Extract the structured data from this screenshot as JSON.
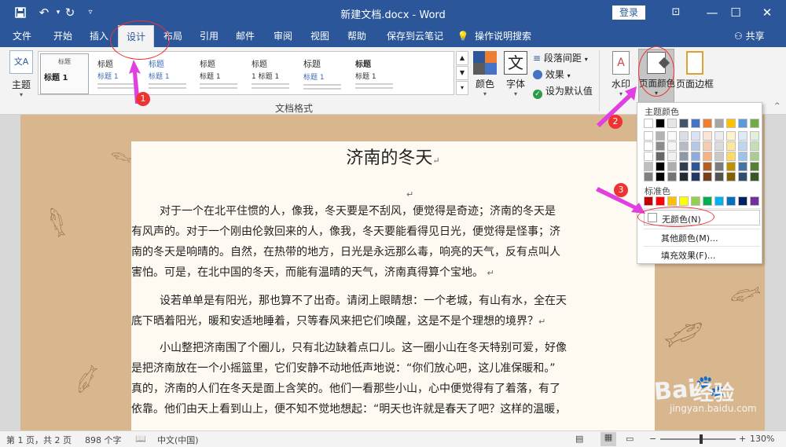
{
  "window": {
    "title": "新建文档.docx  -  Word",
    "login": "登录",
    "save_icon": "save-icon",
    "undo_icon": "undo-icon",
    "redo_icon": "redo-icon",
    "customize_icon": "customize-icon",
    "controls": {
      "display_options": "⊡",
      "minimize": "—",
      "maximize": "☐",
      "close": "✕"
    }
  },
  "tabs": [
    "文件",
    "开始",
    "插入",
    "设计",
    "布局",
    "引用",
    "邮件",
    "审阅",
    "视图",
    "帮助",
    "保存到云笔记",
    "操作说明搜索"
  ],
  "active_tab": "设计",
  "share": "共享",
  "ribbon": {
    "theme_label": "主题",
    "gallery_styles": [
      {
        "head": "标题",
        "sub": "标题 1"
      },
      {
        "head": "标题",
        "sub": "标题 1"
      },
      {
        "head": "标题",
        "sub": "标题 1"
      },
      {
        "head": "标题",
        "sub": "标题 1"
      },
      {
        "head": "标题",
        "sub": "1 标题 1"
      },
      {
        "head": "标题",
        "sub": "标题 1"
      },
      {
        "head": "标题",
        "sub": "标题 1"
      }
    ],
    "colors_label": "颜色",
    "fonts_label": "字体",
    "fonts_glyph": "文",
    "paragraph_spacing_label": "段落间距",
    "effects_label": "效果",
    "set_default_label": "设为默认值",
    "group_label": "文档格式",
    "watermark_label": "水印",
    "page_color_label": "页面颜色",
    "page_borders_label": "页面边框"
  },
  "color_panel": {
    "theme_colors_label": "主题颜色",
    "theme_colors": [
      "#ffffff",
      "#000000",
      "#e7e6e6",
      "#44546a",
      "#4472c4",
      "#ed7d31",
      "#a5a5a5",
      "#ffc000",
      "#5b9bd5",
      "#70ad47"
    ],
    "standard_colors_label": "标准色",
    "standard_colors": [
      "#c00000",
      "#ff0000",
      "#ffc000",
      "#ffff00",
      "#92d050",
      "#00b050",
      "#00b0f0",
      "#0070c0",
      "#002060",
      "#7030a0"
    ],
    "no_color": "无颜色(N)",
    "more_colors": "其他颜色(M)...",
    "fill_effects": "填充效果(F)..."
  },
  "document": {
    "heading": "济南的冬天",
    "lines": [
      "对于一个在北平住惯的人，像我，冬天要是不刮风，便觉得是奇迹；济南的冬天是",
      "有风声的。对于一个刚由伦敦回来的人，像我，冬天要能看得见日光，便觉得是怪事；济",
      "南的冬天是响晴的。自然，在热带的地方，日光是永远那么毒，响亮的天气，反有点叫人",
      "害怕。可是，在北中国的冬天，而能有温晴的天气，济南真得算个宝地。",
      "设若单单是有阳光，那也算不了出奇。请闭上眼睛想：一个老城，有山有水，全在天",
      "底下晒着阳光，暖和安适地睡着，只等春风来把它们唤醒，这是不是个理想的境界？",
      "小山整把济南围了个圈儿，只有北边缺着点口儿。这一圈小山在冬天特别可爱，好像",
      "是把济南放在一个小摇篮里，它们安静不动地低声地说：“你们放心吧，这儿准保暖和。”",
      "真的，济南的人们在冬天是面上含笑的。他们一看那些小山，心中便觉得有了着落，有了",
      "依靠。他们由天上看到山上，便不知不觉地想起：“明天也许就是春天了吧？这样的温暖，"
    ]
  },
  "status": {
    "pages": "第 1 页，共 2 页",
    "words": "898 个字",
    "language": "中文(中国)",
    "zoom": "130%",
    "zoom_level": 1.3
  },
  "annotations": [
    "1",
    "2",
    "3"
  ],
  "watermark_text": {
    "logo": "Bai",
    "brand": "经验",
    "url": "jingyan.baidu.com"
  }
}
